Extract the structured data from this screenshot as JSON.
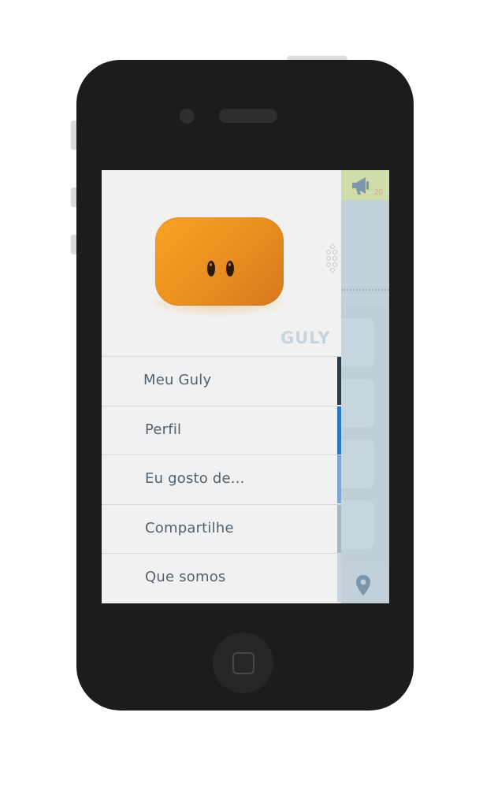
{
  "app": {
    "logo_text": "GULY"
  },
  "background_app": {
    "notification_count": "20"
  },
  "menu": {
    "items": [
      {
        "label": "Meu Guly",
        "color": "#2e3b48"
      },
      {
        "label": "Perfil",
        "color": "#2c77c4"
      },
      {
        "label": "Eu gosto de...",
        "color": "#7ea6d2"
      },
      {
        "label": "Compartilhe",
        "color": "#a5b6c6"
      },
      {
        "label": "Que somos",
        "color": "#c9d4de"
      }
    ]
  },
  "icons": {
    "announcement": "megaphone-icon",
    "location": "map-pin-icon",
    "drawer_handle": "grip-dots-icon"
  },
  "colors": {
    "brand_orange": "#f39c21",
    "header_green": "#cfdcab"
  }
}
